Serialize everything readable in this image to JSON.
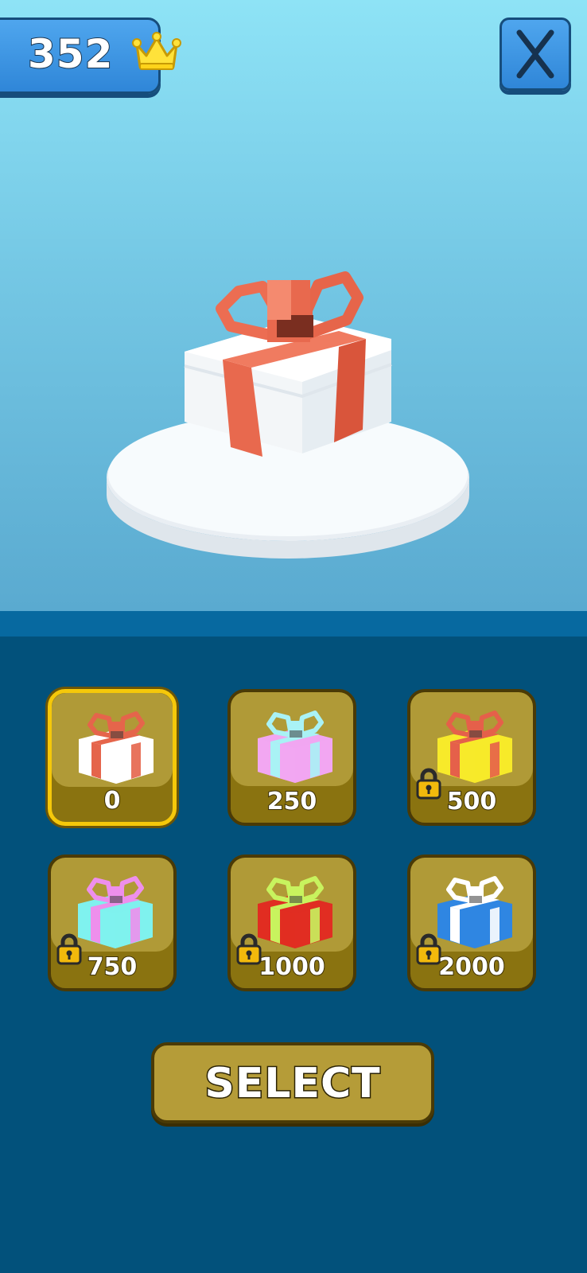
{
  "header": {
    "coins": "352",
    "coin_icon": "crown-icon",
    "close_icon": "close-x-icon"
  },
  "preview": {
    "box_color": "#ffffff",
    "ribbon_color": "#e8694e"
  },
  "gifts": [
    {
      "price": "0",
      "box_color": "#ffffff",
      "ribbon_color": "#e5654b",
      "locked": false,
      "selected": true
    },
    {
      "price": "250",
      "box_color": "#f1a6f1",
      "ribbon_color": "#a9f2f5",
      "locked": false,
      "selected": false
    },
    {
      "price": "500",
      "box_color": "#f7ea2a",
      "ribbon_color": "#e5604a",
      "locked": true,
      "selected": false
    },
    {
      "price": "750",
      "box_color": "#7ff1ee",
      "ribbon_color": "#ee8fec",
      "locked": true,
      "selected": false
    },
    {
      "price": "1000",
      "box_color": "#e02d22",
      "ribbon_color": "#c8f35e",
      "locked": true,
      "selected": false
    },
    {
      "price": "2000",
      "box_color": "#2f86e2",
      "ribbon_color": "#ffffff",
      "locked": true,
      "selected": false
    }
  ],
  "select_button": {
    "label": "SELECT"
  },
  "colors": {
    "sky_top": "#8ee3f6",
    "sky_bottom": "#5aaad0",
    "panel_bg": "#02517b",
    "tile_bg": "#b09a37",
    "highlight": "#f5c80a"
  }
}
